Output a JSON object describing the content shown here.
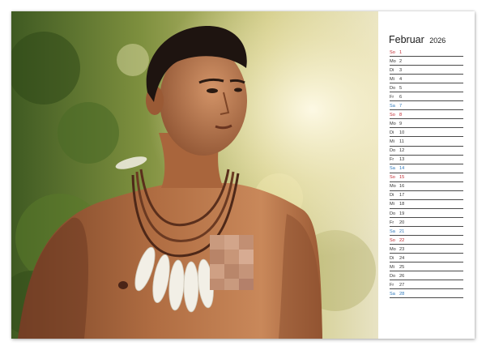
{
  "calendar": {
    "month": "Februar",
    "year": "2026",
    "days": [
      {
        "dow": "So",
        "num": "1",
        "type": "sun"
      },
      {
        "dow": "Mo",
        "num": "2",
        "type": "weekday"
      },
      {
        "dow": "Di",
        "num": "3",
        "type": "weekday"
      },
      {
        "dow": "Mi",
        "num": "4",
        "type": "weekday"
      },
      {
        "dow": "Do",
        "num": "5",
        "type": "weekday"
      },
      {
        "dow": "Fr",
        "num": "6",
        "type": "weekday"
      },
      {
        "dow": "Sa",
        "num": "7",
        "type": "sat"
      },
      {
        "dow": "So",
        "num": "8",
        "type": "sun"
      },
      {
        "dow": "Mo",
        "num": "9",
        "type": "weekday"
      },
      {
        "dow": "Di",
        "num": "10",
        "type": "weekday"
      },
      {
        "dow": "Mi",
        "num": "11",
        "type": "weekday"
      },
      {
        "dow": "Do",
        "num": "12",
        "type": "weekday"
      },
      {
        "dow": "Fr",
        "num": "13",
        "type": "weekday"
      },
      {
        "dow": "Sa",
        "num": "14",
        "type": "sat"
      },
      {
        "dow": "So",
        "num": "15",
        "type": "sun"
      },
      {
        "dow": "Mo",
        "num": "16",
        "type": "weekday"
      },
      {
        "dow": "Di",
        "num": "17",
        "type": "weekday"
      },
      {
        "dow": "Mi",
        "num": "18",
        "type": "weekday"
      },
      {
        "dow": "Do",
        "num": "19",
        "type": "weekday"
      },
      {
        "dow": "Fr",
        "num": "20",
        "type": "weekday"
      },
      {
        "dow": "Sa",
        "num": "21",
        "type": "sat"
      },
      {
        "dow": "So",
        "num": "22",
        "type": "sun"
      },
      {
        "dow": "Mo",
        "num": "23",
        "type": "weekday"
      },
      {
        "dow": "Di",
        "num": "24",
        "type": "weekday"
      },
      {
        "dow": "Mi",
        "num": "25",
        "type": "weekday"
      },
      {
        "dow": "Do",
        "num": "26",
        "type": "weekday"
      },
      {
        "dow": "Fr",
        "num": "27",
        "type": "weekday"
      },
      {
        "dow": "Sa",
        "num": "28",
        "type": "sat"
      }
    ]
  },
  "colors": {
    "sunday": "#c0262e",
    "saturday": "#2b76b9",
    "weekday": "#333333",
    "rule": "#4a4a4a"
  }
}
